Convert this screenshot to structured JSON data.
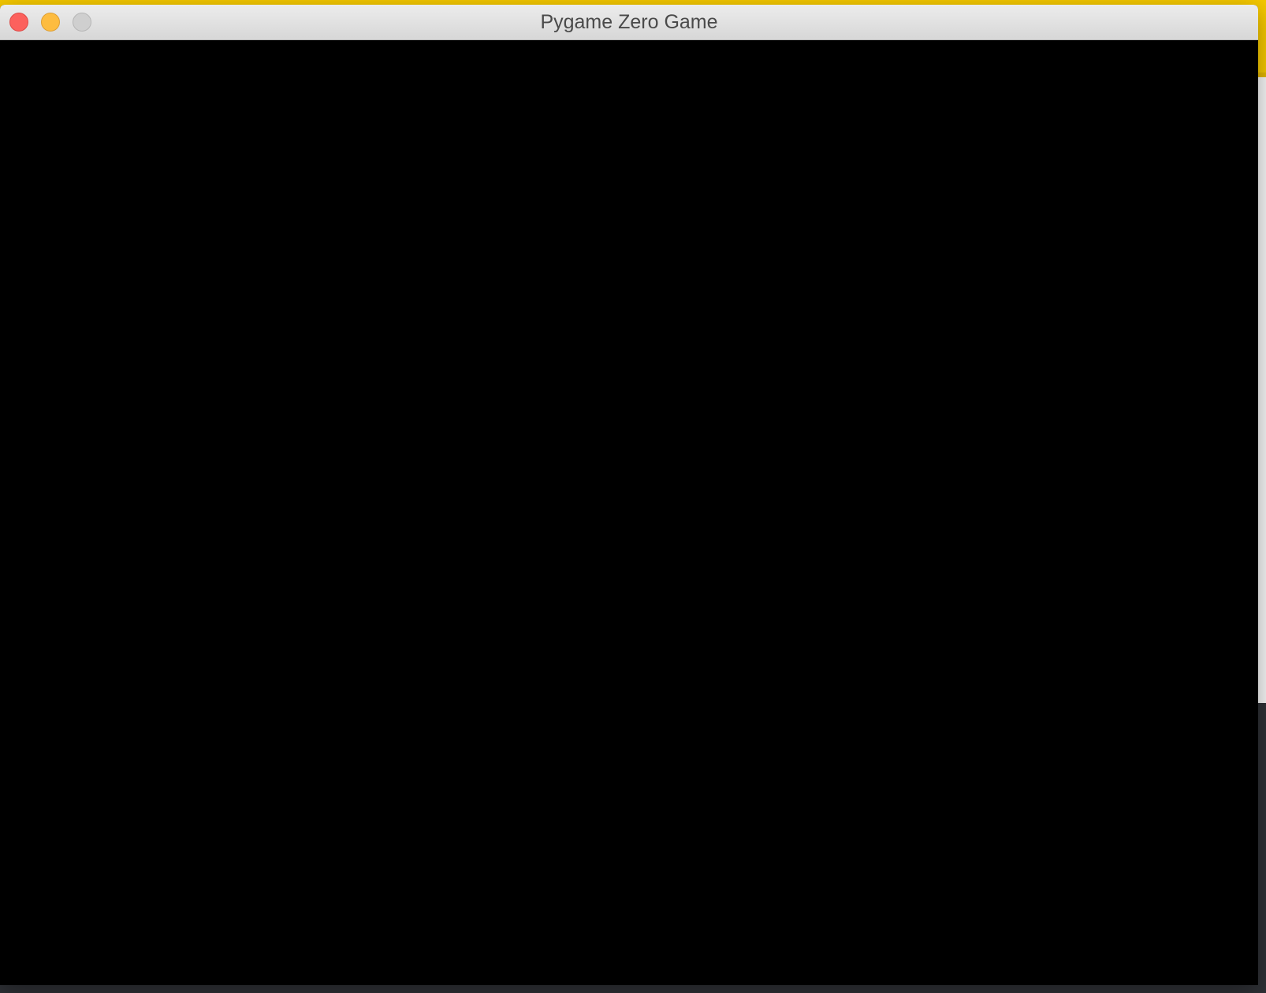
{
  "window": {
    "title": "Pygame Zero Game"
  },
  "canvas": {
    "background_color": "#000000"
  },
  "colors": {
    "background_app_bar": "#f5c800",
    "close_button": "#fc615d",
    "minimize_button": "#fdbc40",
    "zoom_button_disabled": "#cfcfcf"
  }
}
